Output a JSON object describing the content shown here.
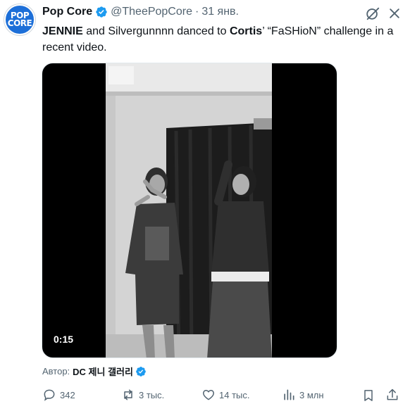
{
  "tweet": {
    "author_name": "Pop Core",
    "handle": "@TheePopCore",
    "separator": "·",
    "timestamp": "31 янв.",
    "avatar_text_top": "POP",
    "avatar_text_bottom": "CORE",
    "text": {
      "part1": "JENNIE",
      "part2": " and Silvergunnnn danced to ",
      "part3": "Cortis",
      "part4": "’ “FaSHioN” challenge in a recent video."
    }
  },
  "media": {
    "duration": "0:15"
  },
  "source": {
    "label": "Автор:",
    "name": "DC 제니 갤러리"
  },
  "actions": {
    "replies": "342",
    "reposts": "3 тыс.",
    "likes": "14 тыс.",
    "views": "3 млн"
  },
  "colors": {
    "verified_blue": "#1d9bf0",
    "muted_text": "#536471",
    "primary_text": "#0f1419"
  }
}
